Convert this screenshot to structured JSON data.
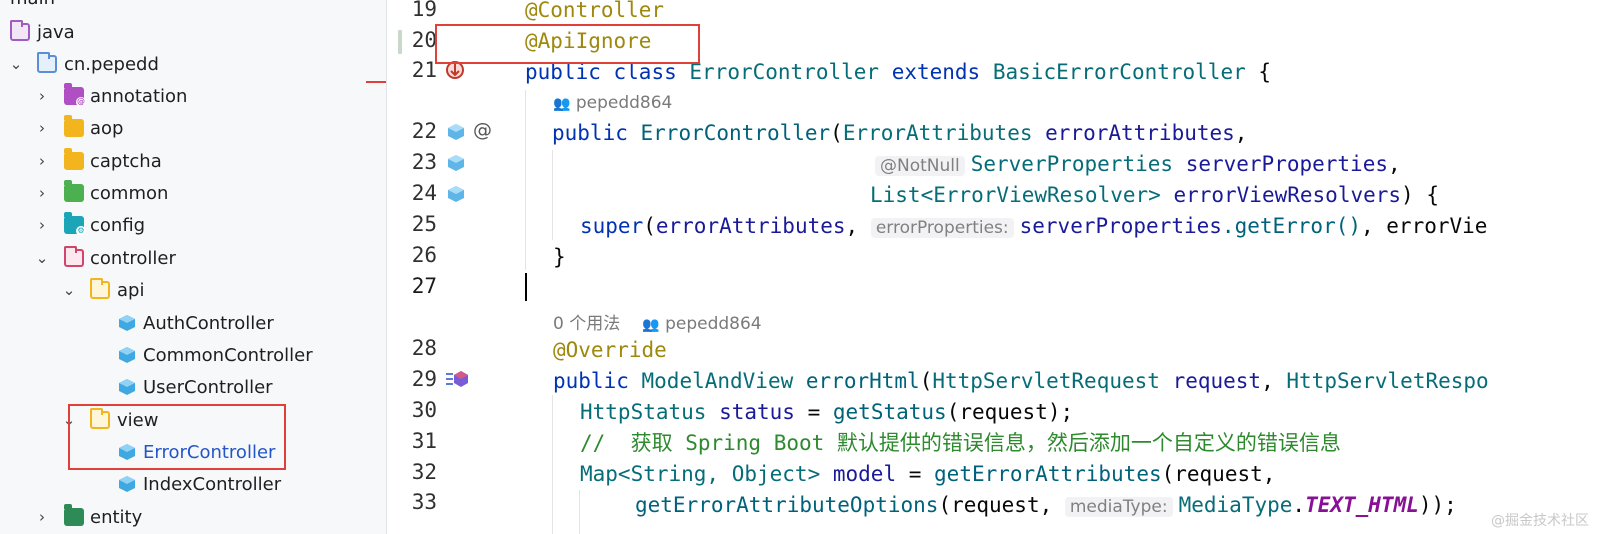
{
  "tree": {
    "top_cut_label": "main",
    "rows": [
      {
        "label": "java"
      },
      {
        "label": "cn.pepedd"
      },
      {
        "label": "annotation"
      },
      {
        "label": "aop"
      },
      {
        "label": "captcha"
      },
      {
        "label": "common"
      },
      {
        "label": "config"
      },
      {
        "label": "controller"
      },
      {
        "label": "api"
      },
      {
        "label": "AuthController"
      },
      {
        "label": "CommonController"
      },
      {
        "label": "UserController"
      },
      {
        "label": "view"
      },
      {
        "label": "ErrorController"
      },
      {
        "label": "IndexController"
      },
      {
        "label": "entity"
      }
    ]
  },
  "editor": {
    "line_numbers": [
      "19",
      "20",
      "21",
      "22",
      "23",
      "24",
      "25",
      "26",
      "27",
      "28",
      "29",
      "30",
      "31",
      "32",
      "33"
    ],
    "code": {
      "l19": "@Controller",
      "l20": "@ApiIgnore",
      "l21_kw1": "public",
      "l21_kw2": "class",
      "l21_cls": "ErrorController",
      "l21_kw3": "extends",
      "l21_base": "BasicErrorController",
      "l21_brace": " {",
      "l22_kw": "public",
      "l22_name": "ErrorController",
      "l22_paren": "(",
      "l22_type": "ErrorAttributes",
      "l22_param": "errorAttributes",
      "l22_comma": ",",
      "l23_hint": "@NotNull",
      "l23_type": "ServerProperties",
      "l23_param": "serverProperties",
      "l23_comma": ",",
      "l24_type": "List<ErrorViewResolver>",
      "l24_param": "errorViewResolvers",
      "l24_end": ") {",
      "l25_kw": "super",
      "l25_a": "(",
      "l25_p1": "errorAttributes",
      "l25_c": ", ",
      "l25_hint": "errorProperties:",
      "l25_p2": "serverProperties",
      "l25_call": ".getError()",
      "l25_rest": ", errorVie",
      "l26": "}",
      "l28": "@Override",
      "l29_kw": "public",
      "l29_type": "ModelAndView",
      "l29_name": "errorHtml",
      "l29_p": "(",
      "l29_t1": "HttpServletRequest",
      "l29_v1": "request",
      "l29_c": ", ",
      "l29_t2": "HttpServletRespo",
      "l30_type": "HttpStatus",
      "l30_var": "status",
      "l30_eq": " = ",
      "l30_call": "getStatus",
      "l30_rest": "(request);",
      "l31_comment": "//  获取 Spring Boot 默认提供的错误信息，然后添加一个自定义的错误信息",
      "l32_type": "Map<String, Object>",
      "l32_var": "model",
      "l32_eq": " = ",
      "l32_call": "getErrorAttributes",
      "l32_rest": "(request,",
      "l33_call": "getErrorAttributeOptions",
      "l33_p": "(request, ",
      "l33_hint": "mediaType:",
      "l33_cls": "MediaType",
      "l33_dot": ".",
      "l33_const": "TEXT_HTML",
      "l33_end": "));"
    },
    "meta": {
      "author1": "pepedd864",
      "usage": "0 个用法",
      "author2": "pepedd864"
    },
    "watermark": "@掘金技术社区"
  },
  "colors": {
    "highlight_box": "#e0403a",
    "selected_text": "#2455c8"
  }
}
